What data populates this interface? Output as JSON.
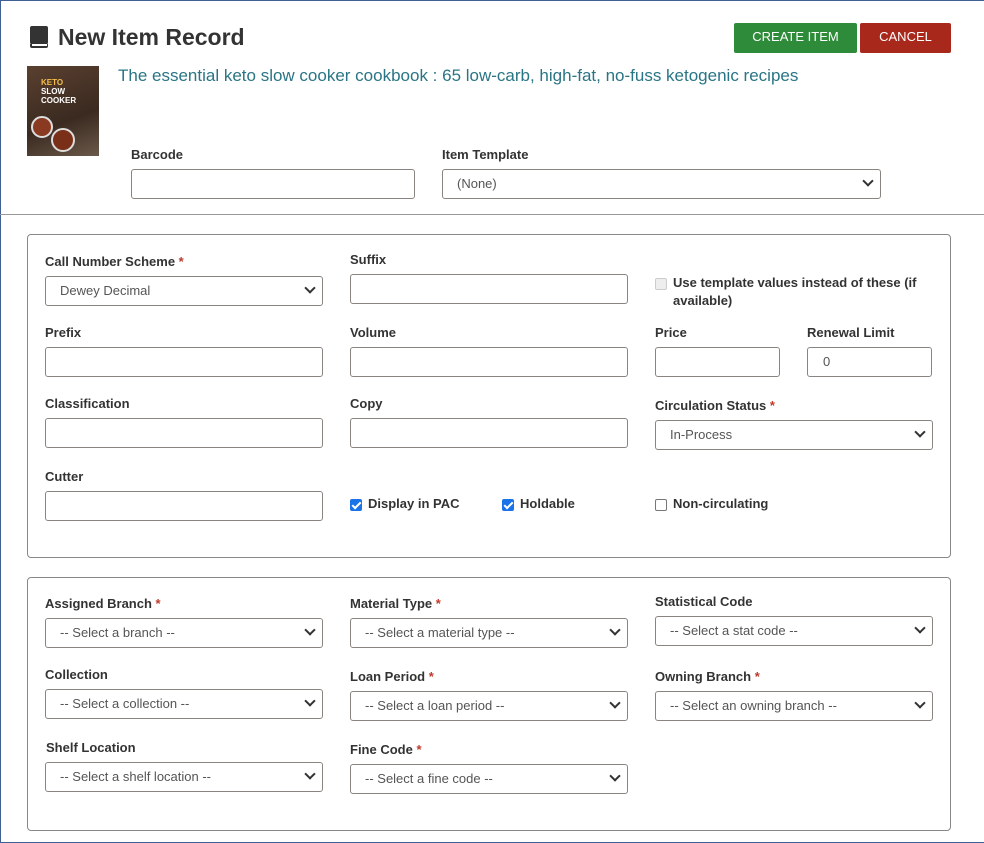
{
  "header": {
    "title": "New Item Record",
    "icon": "book-icon",
    "create_label": "CREATE ITEM",
    "cancel_label": "CANCEL",
    "create_color": "#2e8b3a",
    "cancel_color": "#a8281c"
  },
  "record": {
    "title": "The essential keto slow cooker cookbook : 65 low-carb, high-fat, no-fuss ketogenic recipes",
    "cover_text": "THE ESSENTIAL KETO SLOW COOKER COOKBOOK"
  },
  "top": {
    "barcode_label": "Barcode",
    "barcode_value": "",
    "template_label": "Item Template",
    "template_value": "(None)"
  },
  "call": {
    "scheme_label": "Call Number Scheme",
    "scheme_value": "Dewey Decimal",
    "suffix_label": "Suffix",
    "suffix_value": "",
    "use_template_label": "Use template values instead of these (if available)",
    "use_template_checked": false,
    "prefix_label": "Prefix",
    "volume_label": "Volume",
    "price_label": "Price",
    "renewal_label": "Renewal Limit",
    "renewal_value": "0",
    "classification_label": "Classification",
    "copy_label": "Copy",
    "circ_label": "Circulation Status",
    "circ_value": "In-Process",
    "cutter_label": "Cutter",
    "display_pac_label": "Display in PAC",
    "display_pac_checked": true,
    "holdable_label": "Holdable",
    "holdable_checked": true,
    "noncirc_label": "Non-circulating",
    "noncirc_checked": false
  },
  "assign": {
    "branch_label": "Assigned Branch",
    "branch_value": "-- Select a branch --",
    "material_label": "Material Type",
    "material_value": "-- Select a material type --",
    "stat_label": "Statistical Code",
    "stat_value": "-- Select a stat code --",
    "collection_label": "Collection",
    "collection_value": "-- Select a collection --",
    "loan_label": "Loan Period",
    "loan_value": "-- Select a loan period --",
    "owning_label": "Owning Branch",
    "owning_value": "-- Select an owning branch --",
    "shelf_label": "Shelf Location",
    "shelf_value": "-- Select a shelf location --",
    "fine_label": "Fine Code",
    "fine_value": "-- Select a fine code --"
  },
  "required_mark": "*"
}
